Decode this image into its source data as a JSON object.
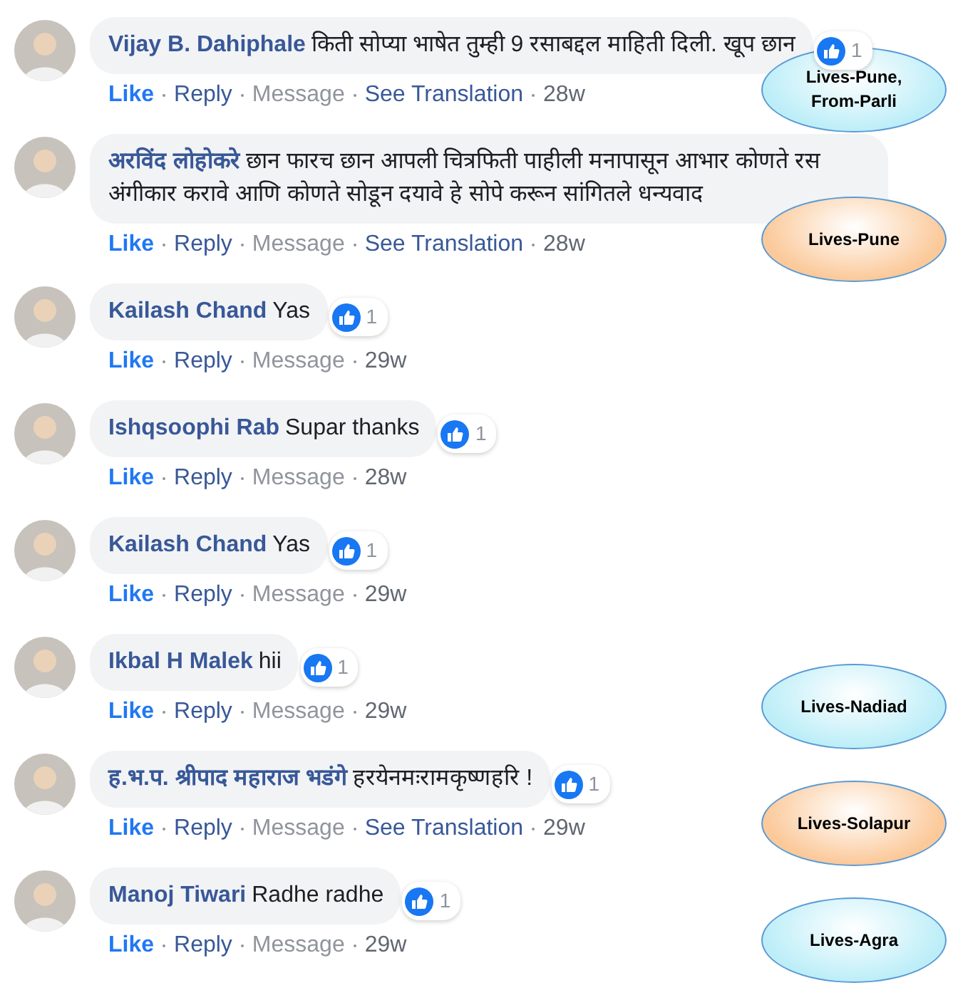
{
  "comments": [
    {
      "name": "Vijay B. Dahiphale",
      "text": "किती सोप्या भाषेत तुम्ही 9 रसाबद्दल माहिती दिली. खूप छान",
      "reactions": "1",
      "actions": [
        {
          "kind": "like",
          "label": "Like"
        },
        {
          "kind": "reply",
          "label": "Reply"
        },
        {
          "kind": "message",
          "label": "Message"
        },
        {
          "kind": "translate",
          "label": "See Translation"
        },
        {
          "kind": "time",
          "label": "28w"
        }
      ],
      "note": {
        "label": "Lives-Pune, From-Parli",
        "color": "#bdeef8"
      }
    },
    {
      "name": "अरविंद लोहोकरे",
      "text": "छान फारच छान आपली चित्रफिती पाहीली मनापासून आभार कोणते रस अंगीकार करावे आणि कोणते सोडून दयावे हे सोपे करून सांगितले धन्यवाद",
      "actions": [
        {
          "kind": "like",
          "label": "Like"
        },
        {
          "kind": "reply",
          "label": "Reply"
        },
        {
          "kind": "message",
          "label": "Message"
        },
        {
          "kind": "translate",
          "label": "See Translation"
        },
        {
          "kind": "time",
          "label": "28w"
        }
      ],
      "note": {
        "label": "Lives-Pune",
        "color": "#fbc99a"
      }
    },
    {
      "name": "Kailash Chand",
      "text": "Yas",
      "reactions": "1",
      "actions": [
        {
          "kind": "like",
          "label": "Like"
        },
        {
          "kind": "reply",
          "label": "Reply"
        },
        {
          "kind": "message",
          "label": "Message"
        },
        {
          "kind": "time",
          "label": "29w"
        }
      ]
    },
    {
      "name": "Ishqsoophi Rab",
      "text": "Supar thanks",
      "reactions": "1",
      "actions": [
        {
          "kind": "like",
          "label": "Like"
        },
        {
          "kind": "reply",
          "label": "Reply"
        },
        {
          "kind": "message",
          "label": "Message"
        },
        {
          "kind": "time",
          "label": "28w"
        }
      ]
    },
    {
      "name": "Kailash Chand",
      "text": "Yas",
      "reactions": "1",
      "actions": [
        {
          "kind": "like",
          "label": "Like"
        },
        {
          "kind": "reply",
          "label": "Reply"
        },
        {
          "kind": "message",
          "label": "Message"
        },
        {
          "kind": "time",
          "label": "29w"
        }
      ]
    },
    {
      "name": "Ikbal H Malek",
      "text": "hii",
      "reactions": "1",
      "actions": [
        {
          "kind": "like",
          "label": "Like"
        },
        {
          "kind": "reply",
          "label": "Reply"
        },
        {
          "kind": "message",
          "label": "Message"
        },
        {
          "kind": "time",
          "label": "29w"
        }
      ],
      "note": {
        "label": "Lives-Nadiad",
        "color": "#bdeef8"
      }
    },
    {
      "name": "ह.भ.प. श्रीपाद महाराज भडंगे",
      "text": "हरयेनमःरामकृष्णहरि !",
      "reactions": "1",
      "actions": [
        {
          "kind": "like",
          "label": "Like"
        },
        {
          "kind": "reply",
          "label": "Reply"
        },
        {
          "kind": "message",
          "label": "Message"
        },
        {
          "kind": "translate",
          "label": "See Translation"
        },
        {
          "kind": "time",
          "label": "29w"
        }
      ],
      "note": {
        "label": "Lives-Solapur",
        "color": "#fbc99a"
      }
    },
    {
      "name": "Manoj Tiwari",
      "text": "Radhe radhe",
      "reactions": "1",
      "actions": [
        {
          "kind": "like",
          "label": "Like"
        },
        {
          "kind": "reply",
          "label": "Reply"
        },
        {
          "kind": "message",
          "label": "Message"
        },
        {
          "kind": "time",
          "label": "29w"
        }
      ],
      "note": {
        "label": "Lives-Agra",
        "color": "#bdeef8"
      }
    }
  ]
}
